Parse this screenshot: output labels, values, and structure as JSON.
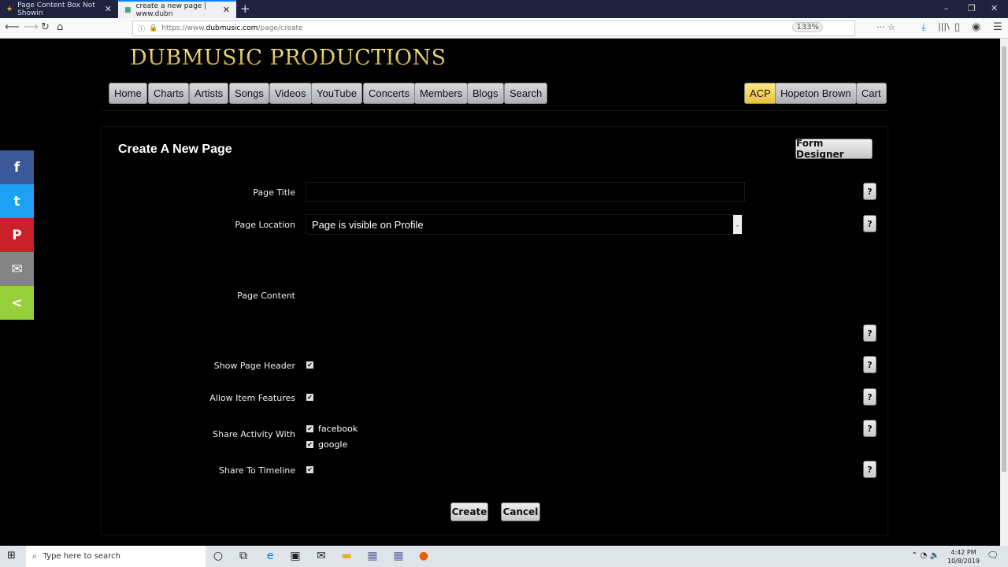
{
  "browser": {
    "tabs": [
      {
        "label": "Page Content Box Not Showin",
        "close": "✕"
      },
      {
        "label": "create a new page | www.dubn",
        "close": "✕"
      }
    ],
    "new_tab": "+",
    "url_prefix": "https://www.",
    "url_host": "dubmusic.com",
    "url_path": "/page/create",
    "zoom": "133%",
    "window_controls": {
      "minimize": "–",
      "restore": "❐",
      "close": "✕"
    }
  },
  "site": {
    "logo": "DUBMUSIC PRODUCTIONS",
    "nav": [
      "Home",
      "Charts",
      "Artists",
      "Songs",
      "Videos",
      "YouTube",
      "Concerts",
      "Members",
      "Blogs",
      "Search"
    ],
    "nav_right": [
      "ACP",
      "Hopeton Brown",
      "Cart"
    ]
  },
  "form": {
    "title": "Create A New Page",
    "form_designer": "Form Designer",
    "page_title_label": "Page Title",
    "page_title_value": "",
    "page_location_label": "Page Location",
    "page_location_value": "Page is visible on Profile",
    "page_content_label": "Page Content",
    "show_header_label": "Show Page Header",
    "allow_features_label": "Allow Item Features",
    "share_activity_label": "Share Activity With",
    "share_facebook": "facebook",
    "share_google": "google",
    "share_timeline_label": "Share To Timeline",
    "help": "?",
    "check": "✔",
    "create": "Create",
    "cancel": "Cancel"
  },
  "social": {
    "facebook": "f",
    "twitter": "t",
    "pinterest": "P",
    "email": "✉",
    "share": "<"
  },
  "taskbar": {
    "search_placeholder": "Type here to search",
    "time": "4:42 PM",
    "date": "10/8/2019"
  }
}
